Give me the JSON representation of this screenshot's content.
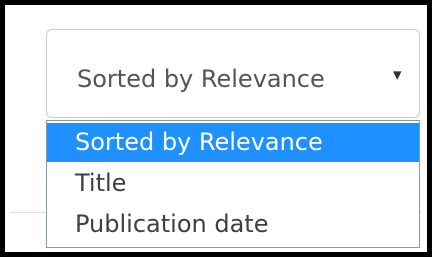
{
  "sort_select": {
    "selected_label": "Sorted by Relevance",
    "arrow_icon": "▾",
    "options": [
      {
        "label": "Sorted by Relevance",
        "highlighted": true
      },
      {
        "label": "Title",
        "highlighted": false
      },
      {
        "label": "Publication date",
        "highlighted": false
      }
    ]
  },
  "colors": {
    "highlight": "#1e90ff",
    "option_text": "#404040",
    "frame_border": "#000000"
  }
}
